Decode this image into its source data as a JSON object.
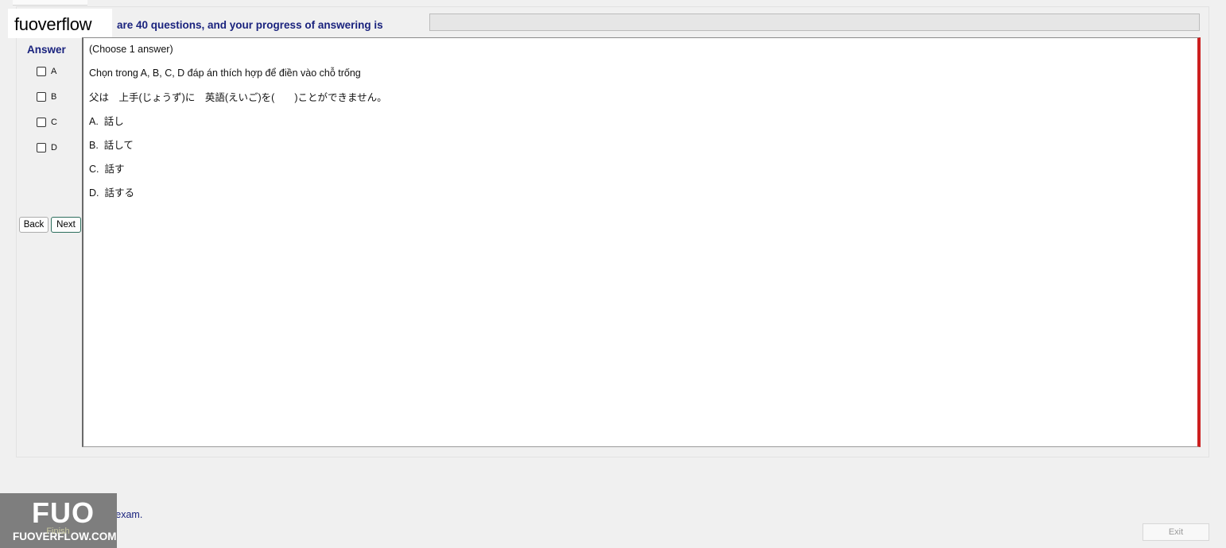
{
  "brand": {
    "name": "fuoverflow"
  },
  "header": {
    "progress_text": "are 40 questions, and your progress of answering is",
    "progress_fraction": 0
  },
  "answer_panel": {
    "title": "Answer",
    "options": [
      "A",
      "B",
      "C",
      "D"
    ],
    "back_label": "Back",
    "next_label": "Next"
  },
  "question": {
    "hint": "(Choose 1 answer)",
    "instruction": "Chọn trong A, B, C, D đáp án thích hợp để điền vào chỗ trống",
    "sentence": "父は　上手(じょうず)に　英語(えいご)を(　　)ことができません。",
    "choices": [
      "A.  話し",
      "B.  話して",
      "C.  話す",
      "D.  話する"
    ]
  },
  "footer": {
    "finish_label": "want to finish the exam.",
    "finish_button": "Finish",
    "exit_button": "Exit",
    "logo_big": "FUO",
    "logo_small": "FUOVERFLOW.COM"
  },
  "colors": {
    "accent_text": "#1a237e",
    "scroll_border": "#cc1f1f",
    "progress_fill": "#06b025"
  }
}
